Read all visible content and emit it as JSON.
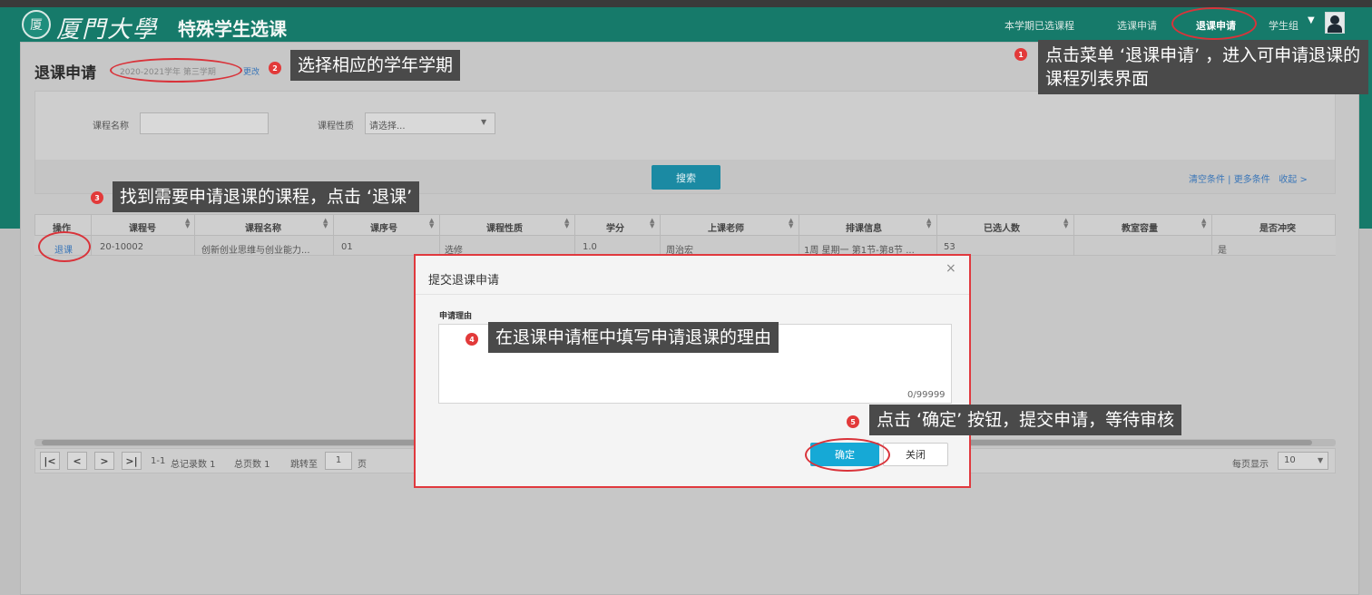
{
  "header": {
    "logo_emblem": "厦",
    "logo_text": "厦門大學",
    "app_title": "特殊学生选课",
    "nav": {
      "enrolled": "本学期已选课程",
      "select_apply": "选课申请",
      "drop_apply": "退课申请",
      "user": "学生组"
    }
  },
  "page": {
    "heading": "退课申请",
    "term": "2020-2021学年 第三学期",
    "change_link": "更改"
  },
  "search": {
    "course_name_label": "课程名称",
    "course_type_label": "课程性质",
    "course_type_placeholder": "请选择...",
    "search_button": "搜索",
    "links": {
      "clear": "清空条件",
      "separator": " | ",
      "more": "更多条件",
      "collapse": "收起 >"
    }
  },
  "table": {
    "headers": [
      "操作",
      "课程号",
      "课程名称",
      "课序号",
      "课程性质",
      "学分",
      "上课老师",
      "排课信息",
      "已选人数",
      "教室容量",
      "是否冲突"
    ],
    "rows": [
      {
        "action": "退课",
        "course_no": "20-10002",
        "course_name": "创新创业思维与创业能力...",
        "section": "01",
        "type": "选修",
        "credit": "1.0",
        "teacher": "周治宏",
        "schedule": "1周 星期一 第1节-第8节 ...",
        "enrolled": "53",
        "capacity": "",
        "conflict": "是"
      }
    ]
  },
  "pager": {
    "first": "|<",
    "prev": "<",
    "next": ">",
    "last": ">|",
    "range": "1-1",
    "total_records": "总记录数 1",
    "total_pages": "总页数 1",
    "jump_label": "跳转至",
    "jump_value": "1",
    "page_unit": "页",
    "per_page_label": "每页显示",
    "per_page_value": "10"
  },
  "modal": {
    "title": "提交退课申请",
    "close_symbol": "×",
    "reason_label": "申请理由",
    "char_count": "0/99999",
    "confirm": "确定",
    "close": "关闭"
  },
  "callouts": [
    {
      "num": "1",
      "text": "点击菜单 ‘退课申请’ ，进入可申请退课的课程列表界面"
    },
    {
      "num": "2",
      "text": "选择相应的学年学期"
    },
    {
      "num": "3",
      "text": "找到需要申请退课的课程，点击 ‘退课’"
    },
    {
      "num": "4",
      "text": "在退课申请框中填写申请退课的理由"
    },
    {
      "num": "5",
      "text": "点击 ‘确定’ 按钮，提交申请，等待审核"
    }
  ],
  "colors": {
    "header_teal": "#167a6a",
    "accent_red": "#e0393e",
    "confirm_blue": "#16a9d6",
    "link_blue": "#3a76b8"
  }
}
